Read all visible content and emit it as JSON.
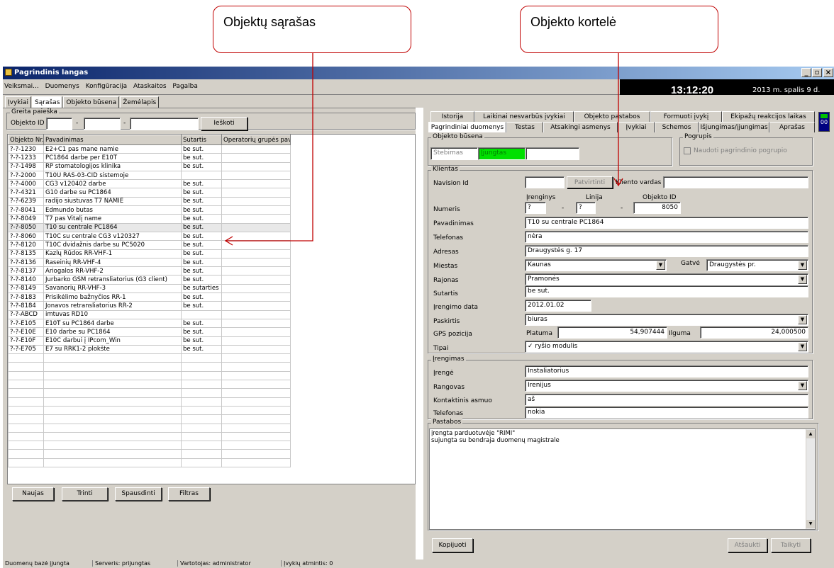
{
  "callouts": {
    "left": "Objektų sąrašas",
    "right": "Objekto kortelė"
  },
  "window": {
    "title": "Pagrindinis langas",
    "controls": [
      "_",
      "▫",
      "×"
    ]
  },
  "menu": [
    "Veiksmai...",
    "Duomenys",
    "Konfigūracija",
    "Ataskaitos",
    "Pagalba"
  ],
  "clock": {
    "time": "13:12:20",
    "date": "2013 m. spalis 9 d."
  },
  "main_tabs": [
    "Įvykiai",
    "Sąrašas",
    "Objekto būsena",
    "Žemėlapis"
  ],
  "quick_search": {
    "group_title": "Greita paieška",
    "label": "Objekto ID",
    "dash": "-",
    "button": "Ieškoti"
  },
  "list": {
    "columns": [
      "Objekto Nr.",
      "Pavadinimas",
      "Sutartis",
      "Operatorių grupės pav..."
    ],
    "rows": [
      [
        "?-?-1230",
        "E2+C1 pas mane namie",
        "be sut."
      ],
      [
        "?-?-1233",
        "PC1864 darbe per E10T",
        "be sut."
      ],
      [
        "?-?-1498",
        "RP stomatologijos klinika",
        "be sut."
      ],
      [
        "?-?-2000",
        "T10U RAS-03-CID sistemoje",
        ""
      ],
      [
        "?-?-4000",
        "CG3 v120402 darbe",
        "be sut."
      ],
      [
        "?-?-4321",
        "G10 darbe su PC1864",
        "be sut."
      ],
      [
        "?-?-6239",
        "radijo siustuvas T7 NAMIE",
        "be sut."
      ],
      [
        "?-?-8041",
        "Edmundo butas",
        "be sut."
      ],
      [
        "?-?-8049",
        "T7 pas Vitalį name",
        "be sut."
      ],
      [
        "?-?-8050",
        "T10 su centrale PC1864",
        "be sut."
      ],
      [
        "?-?-8060",
        "T10C su centrale CG3 v120327",
        "be sut."
      ],
      [
        "?-?-8120",
        "T10C dvidažnis darbe su PC5020",
        "be sut."
      ],
      [
        "?-?-8135",
        "Kazlų Rūdos RR-VHF-1",
        "be sut."
      ],
      [
        "?-?-8136",
        "Raseinių RR-VHF-4",
        "be sut."
      ],
      [
        "?-?-8137",
        "Ariogalos RR-VHF-2",
        "be sut."
      ],
      [
        "?-?-8140",
        "Jurbarko GSM retransliatorius (G3 client)",
        "be sut."
      ],
      [
        "?-?-8149",
        "Savanorių RR-VHF-3",
        "be sutarties"
      ],
      [
        "?-?-8183",
        "Prisikėlimo bažnyčios RR-1",
        "be sut."
      ],
      [
        "?-?-8184",
        "Jonavos retransliatorius RR-2",
        "be sut."
      ],
      [
        "?-?-ABCD",
        "imtuvas RD10",
        ""
      ],
      [
        "?-?-E105",
        "E10T su PC1864 darbe",
        "be sut."
      ],
      [
        "?-?-E10E",
        "E10 darbe su PC1864",
        "be sut."
      ],
      [
        "?-?-E10F",
        "E10C darbui į IPcom_Win",
        "be sut."
      ],
      [
        "?-?-E705",
        "E7 su RRK1-2 plokšte",
        "be sut."
      ]
    ],
    "selected_index": 9,
    "buttons": [
      "Naujas",
      "Trinti",
      "Spausdinti",
      "Filtras"
    ]
  },
  "card": {
    "tabs_top": [
      "Istorija",
      "Laikinai nesvarbūs įvykiai",
      "Objekto pastabos",
      "Formuoti įvykį",
      "Ekipažų reakcijos laikas"
    ],
    "tabs_bottom": [
      "Pagrindiniai duomenys",
      "Testas",
      "Atsakingi asmenys",
      "Įvykiai",
      "Schemos",
      "Išjungimas/įjungimas",
      "Aprašas"
    ],
    "side_tab": "00",
    "state_group": "Objekto būsena",
    "state_watch": "Stebimas",
    "state_status": "Įjungtas",
    "subgroup_title": "Pogrupis",
    "subgroup_check": "Naudoti pagrindinio pogrupio",
    "client_group": "Klientas",
    "navision_label": "Navision Id",
    "confirm_btn": "Patvirtinti",
    "client_name_label": "Kliento vardas",
    "col_device": "Įrenginys",
    "col_line": "Linija",
    "col_object_id": "Objekto ID",
    "number_label": "Numeris",
    "device_val": "?",
    "line_val": "?",
    "object_id_val": "8050",
    "name_label": "Pavadinimas",
    "name_val": "T10 su centrale PC1864",
    "phone_label": "Telefonas",
    "phone_val": "nėra",
    "address_label": "Adresas",
    "address_val": "Draugystės g. 17",
    "city_label": "Miestas",
    "city_val": "Kaunas",
    "street_label": "Gatvė",
    "street_val": "Draugystės pr.",
    "district_label": "Rajonas",
    "district_val": "Pramonės",
    "contract_label": "Sutartis",
    "contract_val": "be sut.",
    "install_date_label": "Įrengimo data",
    "install_date_val": "2012.01.02",
    "purpose_label": "Paskirtis",
    "purpose_val": "biuras",
    "gps_label": "GPS pozicija",
    "lat_label": "Platuma",
    "lat_val": "54,907444",
    "lon_label": "Ilguma",
    "lon_val": "24,000500",
    "types_label": "Tipai",
    "types_val": "✓ ryšio modulis",
    "install_group": "Įrengimas",
    "installer_label": "Įrengė",
    "installer_val": "Instaliatorius",
    "contractor_label": "Rangovas",
    "contractor_val": "Irenijus",
    "contact_label": "Kontaktinis asmuo",
    "contact_val": "aš",
    "contact_phone_label": "Telefonas",
    "contact_phone_val": "nokia",
    "notes_group": "Pastabos",
    "notes_line1": "įrengta parduotuvėje \"RIMI\"",
    "notes_line2": "sujungta su bendraja duomenų magistrale",
    "copy_btn": "Kopijuoti",
    "cancel_btn": "Atšaukti",
    "save_btn": "Taikyti"
  },
  "status": [
    "Duomenų bazė įjungta",
    "Serveris: prijungtas",
    "Vartotojas: administrator",
    "Įvykių atmintis: 0"
  ],
  "colors": {
    "status_green": "#00e000",
    "arrow_red": "#c00000",
    "title_blue": "#0a246a"
  }
}
